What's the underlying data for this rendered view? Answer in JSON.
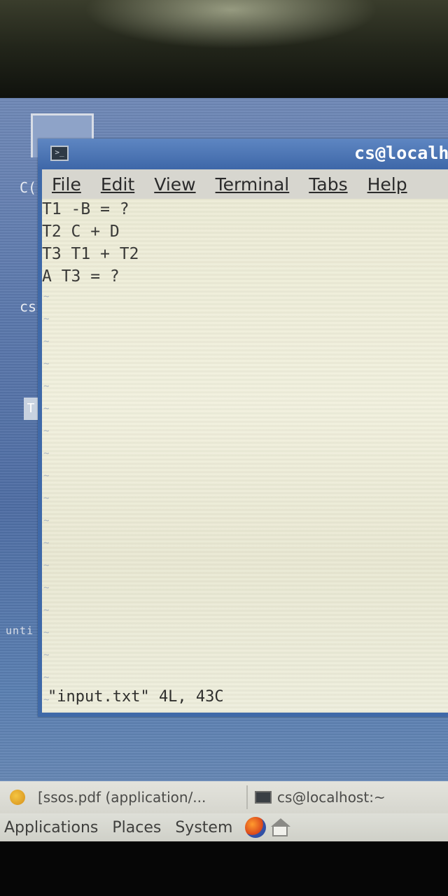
{
  "window": {
    "title": "cs@localh",
    "icon": "terminal-icon"
  },
  "menubar": {
    "items": [
      {
        "label": "File"
      },
      {
        "label": "Edit"
      },
      {
        "label": "View"
      },
      {
        "label": "Terminal"
      },
      {
        "label": "Tabs"
      },
      {
        "label": "Help"
      }
    ]
  },
  "editor": {
    "lines": [
      "T1 -B = ?",
      "T2 C + D",
      "T3 T1 + T2",
      "A T3 = ?"
    ],
    "empty_line_marker": "~",
    "status": "\"input.txt\" 4L, 43C"
  },
  "background_window": {
    "partial_text_1": "C(",
    "partial_text_2": "cs",
    "partial_text_3": "T",
    "partial_text_4": "unti"
  },
  "taskbar": {
    "tasks": [
      {
        "label": "[ssos.pdf (application/...",
        "icon": "pdf-viewer-icon"
      },
      {
        "label": "cs@localhost:~",
        "icon": "terminal-icon"
      }
    ]
  },
  "panel": {
    "menus": [
      {
        "label": "Applications"
      },
      {
        "label": "Places"
      },
      {
        "label": "System"
      }
    ],
    "launchers": [
      "firefox-icon",
      "home-icon"
    ]
  }
}
